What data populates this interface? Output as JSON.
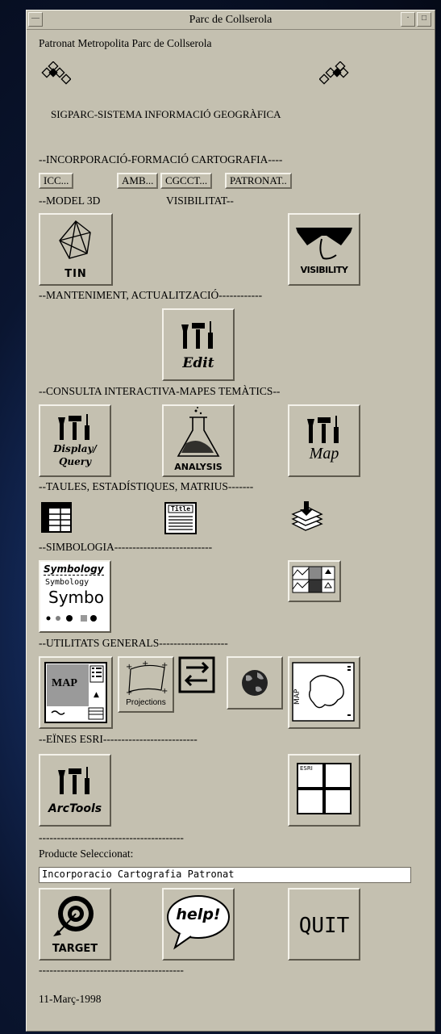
{
  "window": {
    "title": "Parc de Collserola"
  },
  "header": {
    "org": "Patronat Metropolita Parc de Collserola",
    "system": "SIGPARC-SISTEMA INFORMACIÓ GEOGRÀFICA"
  },
  "sections": {
    "incorporacio": "--INCORPORACIÓ-FORMACIÓ CARTOGRAFIA----",
    "model3d": "--MODEL 3D",
    "visibilitat": "VISIBILITAT--",
    "manteniment": "--MANTENIMENT, ACTUALITZACIÓ------------",
    "consulta": "--CONSULTA INTERACTIVA-MAPES TEMÀTICS--",
    "taules": "--TAULES, ESTADÍSTIQUES, MATRIUS-------",
    "simbologia": "--SIMBOLOGIA---------------------------",
    "utilitats": "--UTILITATS GENERALS-------------------",
    "eines": "--EÏNES ESRI--------------------------",
    "sep1": "----------------------------------------",
    "sep2": "----------------------------------------"
  },
  "buttons": {
    "icc": "ICC...",
    "amb": "AMB...",
    "cgcct": "CGCCT...",
    "patronat": "PATRONAT..",
    "tin": "TIN",
    "visibility": "VISIBILITY",
    "edit": "Edit",
    "display_query_1": "Display/",
    "display_query_2": "Query",
    "analysis": "ANALYSIS",
    "map": "Map",
    "table_title": "Title",
    "symbology_1": "Symbology",
    "symbology_2": "Symbology",
    "symbology_3": "Symbo",
    "map_layout": "MAP",
    "projections": "Projections",
    "arctools": "ArcTools",
    "esri": "ESRI",
    "target": "TARGET",
    "help": "help!",
    "quit": "QUIT"
  },
  "product": {
    "label": "Producte Seleccionat:",
    "value": "Incorporacio Cartografia Patronat"
  },
  "date": "11-Març-1998",
  "icons": [
    "diamond-logo-icon",
    "tin-icon",
    "visibility-glasses-icon",
    "tools-icon",
    "flask-icon",
    "table-icon",
    "title-report-icon",
    "layers-icon",
    "symbology-icon",
    "patterns-icon",
    "map-layout-icon",
    "projections-icon",
    "swap-arrows-icon",
    "globe-icon",
    "map-view-icon",
    "esri-grid-icon",
    "target-icon",
    "help-bubble-icon"
  ]
}
